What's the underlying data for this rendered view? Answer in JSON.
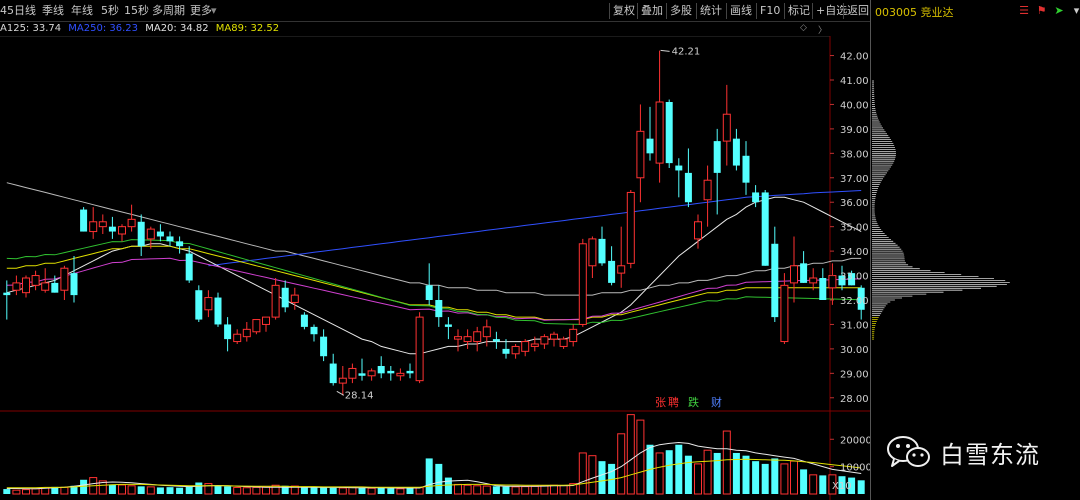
{
  "toolbar": {
    "left_items": [
      "45日线",
      "季线",
      "年线",
      "5秒",
      "15秒",
      "多周期",
      "更多"
    ],
    "right_items": [
      "复权",
      "叠加",
      "多股",
      "统计",
      "画线",
      "F10",
      "标记",
      "+自选",
      "返回"
    ]
  },
  "ma_legend": [
    {
      "text": "A125: 33.74",
      "color": "#d8d8d8"
    },
    {
      "text": "MA250: 36.23",
      "color": "#3050ff"
    },
    {
      "text": "MA20: 34.82",
      "color": "#e0e0e0"
    },
    {
      "text": "MA89: 32.52",
      "color": "#e0e000"
    }
  ],
  "stock": {
    "code_name": "003005 竞业达"
  },
  "price_axis": [
    "42.00",
    "41.00",
    "40.00",
    "39.00",
    "38.00",
    "37.00",
    "36.00",
    "35.00",
    "34.00",
    "33.00",
    "32.00",
    "31.00",
    "30.00",
    "29.00",
    "28.00"
  ],
  "volume_axis": [
    "20000",
    "10000"
  ],
  "volume_unit": "X10",
  "annotations": {
    "high": "42.21",
    "low": "28.14"
  },
  "badges": [
    {
      "text": "张",
      "color": "#ff3030"
    },
    {
      "text": "聘",
      "color": "#ff3030"
    },
    {
      "text": "跌",
      "color": "#40d040"
    },
    {
      "text": "财",
      "color": "#5080ff"
    }
  ],
  "watermark": {
    "text": "白雪东流"
  },
  "colors": {
    "up": "#ff3232",
    "down": "#54ffff",
    "profile_up": "#f0f0f0",
    "profile_down": "#e8e000"
  },
  "chart_data": {
    "type": "candlestick",
    "candles": [
      [
        32.3,
        32.8,
        31.2,
        32.2
      ],
      [
        32.4,
        33.0,
        32.2,
        32.7
      ],
      [
        32.3,
        33.0,
        32.1,
        32.9
      ],
      [
        32.6,
        33.2,
        32.4,
        33.0
      ],
      [
        32.4,
        33.3,
        32.3,
        32.7
      ],
      [
        32.7,
        33.0,
        32.3,
        32.3
      ],
      [
        32.4,
        33.4,
        32.0,
        33.3
      ],
      [
        33.1,
        33.8,
        31.9,
        32.2
      ],
      [
        35.7,
        35.8,
        34.8,
        34.8
      ],
      [
        34.8,
        35.8,
        34.5,
        35.2
      ],
      [
        35.0,
        35.5,
        34.7,
        35.2
      ],
      [
        35.0,
        35.4,
        34.5,
        34.8
      ],
      [
        34.7,
        35.1,
        34.4,
        35.0
      ],
      [
        35.0,
        35.9,
        34.8,
        35.3
      ],
      [
        35.2,
        35.5,
        33.8,
        34.2
      ],
      [
        34.5,
        35.0,
        34.1,
        34.9
      ],
      [
        34.8,
        35.1,
        34.4,
        34.6
      ],
      [
        34.6,
        34.8,
        34.2,
        34.4
      ],
      [
        34.4,
        34.6,
        33.9,
        34.2
      ],
      [
        33.9,
        34.2,
        32.7,
        32.8
      ],
      [
        32.4,
        32.6,
        31.1,
        31.2
      ],
      [
        31.6,
        32.4,
        31.3,
        32.1
      ],
      [
        32.1,
        32.3,
        30.9,
        31.0
      ],
      [
        31.0,
        31.3,
        29.9,
        30.4
      ],
      [
        30.3,
        30.8,
        30.2,
        30.6
      ],
      [
        30.5,
        31.1,
        30.3,
        30.8
      ],
      [
        30.7,
        31.2,
        30.6,
        31.2
      ],
      [
        31.0,
        31.3,
        30.7,
        31.3
      ],
      [
        31.3,
        32.9,
        31.2,
        32.6
      ],
      [
        32.5,
        32.8,
        31.5,
        31.7
      ],
      [
        31.9,
        32.5,
        31.6,
        32.2
      ],
      [
        31.4,
        31.5,
        30.8,
        30.9
      ],
      [
        30.9,
        31.0,
        30.3,
        30.6
      ],
      [
        30.5,
        30.8,
        29.5,
        29.7
      ],
      [
        29.4,
        29.8,
        28.5,
        28.6
      ],
      [
        28.6,
        29.3,
        28.1,
        28.8
      ],
      [
        28.8,
        29.4,
        28.6,
        29.2
      ],
      [
        29.0,
        29.6,
        28.7,
        28.9
      ],
      [
        28.9,
        29.2,
        28.7,
        29.1
      ],
      [
        29.3,
        29.7,
        28.8,
        29.0
      ],
      [
        29.1,
        29.3,
        28.7,
        29.0
      ],
      [
        28.9,
        29.2,
        28.7,
        29.0
      ],
      [
        29.1,
        29.4,
        28.8,
        29.0
      ],
      [
        28.7,
        31.5,
        28.6,
        31.3
      ],
      [
        32.6,
        33.5,
        31.8,
        32.0
      ],
      [
        32.0,
        32.6,
        30.9,
        31.3
      ],
      [
        31.0,
        31.3,
        30.4,
        30.9
      ],
      [
        30.4,
        30.8,
        29.9,
        30.5
      ],
      [
        30.3,
        30.8,
        30.0,
        30.5
      ],
      [
        30.3,
        30.9,
        29.9,
        30.7
      ],
      [
        30.5,
        31.2,
        30.1,
        30.9
      ],
      [
        30.4,
        30.7,
        30.0,
        30.3
      ],
      [
        30.0,
        30.4,
        29.6,
        29.8
      ],
      [
        29.8,
        30.2,
        29.6,
        30.1
      ],
      [
        29.9,
        30.4,
        29.7,
        30.3
      ],
      [
        30.1,
        30.5,
        29.9,
        30.2
      ],
      [
        30.2,
        30.6,
        30.0,
        30.5
      ],
      [
        30.4,
        30.7,
        30.1,
        30.6
      ],
      [
        30.1,
        30.5,
        30.0,
        30.4
      ],
      [
        30.3,
        31.0,
        30.1,
        30.8
      ],
      [
        31.0,
        34.5,
        30.9,
        34.3
      ],
      [
        33.4,
        34.6,
        32.9,
        34.5
      ],
      [
        34.5,
        35.0,
        33.4,
        33.5
      ],
      [
        33.6,
        34.2,
        32.6,
        32.7
      ],
      [
        33.1,
        35.0,
        32.5,
        33.4
      ],
      [
        33.5,
        36.5,
        33.3,
        36.4
      ],
      [
        37.0,
        40.0,
        36.0,
        38.9
      ],
      [
        38.6,
        39.9,
        37.7,
        38.0
      ],
      [
        37.6,
        42.2,
        36.8,
        40.1
      ],
      [
        40.1,
        40.2,
        37.4,
        37.6
      ],
      [
        37.5,
        37.8,
        36.2,
        37.3
      ],
      [
        37.2,
        38.2,
        35.8,
        36.0
      ],
      [
        34.5,
        35.5,
        34.1,
        35.2
      ],
      [
        36.1,
        37.5,
        35.0,
        36.9
      ],
      [
        38.5,
        39.0,
        35.5,
        37.2
      ],
      [
        38.5,
        40.8,
        37.5,
        39.6
      ],
      [
        38.6,
        39.0,
        37.3,
        37.5
      ],
      [
        37.9,
        38.5,
        36.3,
        36.8
      ],
      [
        36.4,
        36.7,
        35.8,
        36.0
      ],
      [
        36.4,
        36.5,
        33.4,
        33.4
      ],
      [
        34.3,
        35.0,
        31.1,
        31.3
      ],
      [
        30.3,
        33.1,
        30.2,
        32.6
      ],
      [
        32.7,
        34.6,
        31.9,
        33.4
      ],
      [
        33.5,
        34.0,
        32.7,
        32.7
      ],
      [
        32.7,
        33.3,
        32.4,
        32.9
      ],
      [
        32.9,
        33.3,
        32.5,
        32.0
      ],
      [
        32.5,
        33.5,
        31.8,
        33.0
      ],
      [
        33.0,
        33.4,
        32.4,
        32.6
      ],
      [
        33.1,
        33.2,
        32.6,
        32.6
      ],
      [
        32.5,
        32.6,
        31.2,
        31.6
      ]
    ],
    "volume": [
      180,
      140,
      160,
      190,
      220,
      260,
      240,
      300,
      520,
      600,
      480,
      350,
      330,
      300,
      280,
      260,
      240,
      250,
      230,
      280,
      420,
      380,
      300,
      280,
      240,
      230,
      240,
      250,
      320,
      300,
      290,
      260,
      250,
      240,
      230,
      220,
      240,
      230,
      210,
      220,
      200,
      190,
      210,
      230,
      1300,
      1100,
      600,
      350,
      320,
      300,
      290,
      280,
      270,
      260,
      270,
      280,
      300,
      320,
      310,
      380,
      1500,
      1400,
      1200,
      1100,
      2200,
      2900,
      2700,
      1800,
      1500,
      1600,
      1800,
      1400,
      1100,
      1600,
      1500,
      2300,
      1500,
      1400,
      1200,
      1100,
      1300,
      1100,
      1200,
      900,
      700,
      680,
      700,
      650,
      600,
      500
    ],
    "ma_price": {
      "MA125": [
        36.8,
        36.7,
        36.6,
        36.5,
        36.4,
        36.3,
        36.2,
        36.1,
        36.0,
        35.9,
        35.8,
        35.7,
        35.6,
        35.5,
        35.4,
        35.3,
        35.2,
        35.1,
        35.0,
        34.9,
        34.8,
        34.7,
        34.6,
        34.5,
        34.4,
        34.3,
        34.2,
        34.1,
        34.0,
        34.0,
        33.9,
        33.8,
        33.7,
        33.6,
        33.5,
        33.4,
        33.3,
        33.2,
        33.1,
        33.0,
        32.9,
        32.8,
        32.7,
        32.7,
        32.6,
        32.6,
        32.5,
        32.5,
        32.5,
        32.4,
        32.4,
        32.4,
        32.3,
        32.3,
        32.3,
        32.3,
        32.2,
        32.2,
        32.2,
        32.2,
        32.2,
        32.2,
        32.3,
        32.3,
        32.3,
        32.4,
        32.4,
        32.5,
        32.6,
        32.6,
        32.7,
        32.7,
        32.8,
        32.8,
        32.9,
        33.0,
        33.0,
        33.1,
        33.2,
        33.2,
        33.3,
        33.3,
        33.4,
        33.4,
        33.5,
        33.5,
        33.6,
        33.6,
        33.7,
        33.7
      ],
      "MA250": [
        null,
        null,
        null,
        null,
        null,
        null,
        null,
        null,
        null,
        null,
        null,
        null,
        null,
        null,
        null,
        null,
        null,
        null,
        null,
        null,
        null,
        33.4,
        33.45,
        33.5,
        33.55,
        33.6,
        33.65,
        33.7,
        33.75,
        33.8,
        33.85,
        33.9,
        33.95,
        34.0,
        34.05,
        34.1,
        34.15,
        34.2,
        34.25,
        34.3,
        34.35,
        34.4,
        34.45,
        34.5,
        34.55,
        34.6,
        34.65,
        34.7,
        34.75,
        34.8,
        34.85,
        34.9,
        34.95,
        35.0,
        35.05,
        35.1,
        35.15,
        35.2,
        35.25,
        35.3,
        35.35,
        35.4,
        35.45,
        35.5,
        35.55,
        35.6,
        35.65,
        35.7,
        35.75,
        35.8,
        35.85,
        35.9,
        35.95,
        36.0,
        36.05,
        36.1,
        36.15,
        36.2,
        36.23,
        36.25,
        36.28,
        36.3,
        36.33,
        36.35,
        36.38,
        36.4,
        36.42,
        36.44,
        36.46,
        36.48
      ],
      "MA20": [
        32.3,
        32.4,
        32.5,
        32.6,
        32.7,
        32.8,
        33.0,
        33.2,
        33.4,
        33.6,
        33.8,
        34.0,
        34.1,
        34.2,
        34.2,
        34.3,
        34.3,
        34.2,
        34.1,
        34.0,
        33.8,
        33.6,
        33.4,
        33.2,
        33.0,
        32.8,
        32.6,
        32.4,
        32.2,
        32.0,
        31.8,
        31.6,
        31.4,
        31.2,
        31.0,
        30.8,
        30.6,
        30.4,
        30.3,
        30.1,
        30.0,
        29.9,
        29.8,
        29.8,
        29.9,
        30.0,
        30.1,
        30.1,
        30.2,
        30.2,
        30.3,
        30.3,
        30.3,
        30.3,
        30.3,
        30.4,
        30.4,
        30.4,
        30.4,
        30.5,
        30.7,
        30.9,
        31.1,
        31.3,
        31.5,
        31.8,
        32.2,
        32.6,
        33.0,
        33.4,
        33.8,
        34.1,
        34.4,
        34.7,
        35.0,
        35.3,
        35.5,
        35.8,
        36.0,
        36.1,
        36.2,
        36.2,
        36.1,
        36.0,
        35.8,
        35.6,
        35.4,
        35.2,
        35.0,
        34.8
      ],
      "MA89": [
        33.3,
        33.3,
        33.4,
        33.4,
        33.5,
        33.5,
        33.6,
        33.7,
        33.8,
        33.9,
        34.0,
        34.1,
        34.1,
        34.2,
        34.2,
        34.2,
        34.2,
        34.2,
        34.1,
        34.1,
        34.0,
        33.9,
        33.8,
        33.7,
        33.6,
        33.5,
        33.4,
        33.3,
        33.2,
        33.1,
        33.0,
        32.9,
        32.8,
        32.7,
        32.6,
        32.5,
        32.4,
        32.3,
        32.2,
        32.1,
        32.0,
        31.9,
        31.8,
        31.8,
        31.8,
        31.7,
        31.7,
        31.6,
        31.6,
        31.5,
        31.5,
        31.4,
        31.4,
        31.3,
        31.3,
        31.3,
        31.2,
        31.2,
        31.2,
        31.2,
        31.2,
        31.3,
        31.3,
        31.4,
        31.4,
        31.5,
        31.6,
        31.7,
        31.8,
        31.9,
        32.0,
        32.1,
        32.2,
        32.3,
        32.3,
        32.4,
        32.4,
        32.5,
        32.5,
        32.5,
        32.5,
        32.5,
        32.5,
        32.5,
        32.5,
        32.5,
        32.5,
        32.5,
        32.5,
        32.5
      ]
    },
    "ma_volume": {
      "short": [
        200,
        200,
        190,
        190,
        210,
        230,
        250,
        280,
        330,
        380,
        420,
        440,
        430,
        410,
        380,
        350,
        320,
        300,
        280,
        270,
        280,
        300,
        310,
        300,
        290,
        270,
        260,
        250,
        250,
        250,
        250,
        250,
        250,
        240,
        240,
        240,
        230,
        230,
        230,
        230,
        220,
        220,
        220,
        220,
        340,
        430,
        470,
        490,
        500,
        450,
        380,
        300,
        280,
        280,
        280,
        280,
        290,
        300,
        300,
        310,
        450,
        580,
        700,
        820,
        1000,
        1250,
        1500,
        1700,
        1800,
        1850,
        1880,
        1850,
        1750,
        1700,
        1650,
        1650,
        1600,
        1580,
        1500,
        1450,
        1400,
        1350,
        1300,
        1200,
        1100,
        1000,
        900,
        850,
        800,
        750
      ],
      "long": [
        230,
        230,
        230,
        230,
        240,
        240,
        250,
        260,
        280,
        300,
        320,
        340,
        350,
        350,
        350,
        340,
        330,
        320,
        310,
        300,
        300,
        300,
        300,
        300,
        290,
        290,
        280,
        280,
        280,
        280,
        270,
        270,
        270,
        260,
        260,
        260,
        260,
        260,
        250,
        250,
        250,
        250,
        250,
        250,
        280,
        310,
        330,
        340,
        350,
        350,
        350,
        340,
        330,
        330,
        320,
        320,
        320,
        320,
        320,
        330,
        380,
        430,
        480,
        530,
        600,
        700,
        800,
        900,
        980,
        1050,
        1100,
        1150,
        1180,
        1200,
        1220,
        1250,
        1260,
        1270,
        1260,
        1250,
        1240,
        1230,
        1210,
        1180,
        1150,
        1110,
        1070,
        1030,
        990,
        950
      ]
    },
    "price_range": [
      27.5,
      42.8
    ],
    "volume_range": [
      0,
      28500
    ]
  }
}
